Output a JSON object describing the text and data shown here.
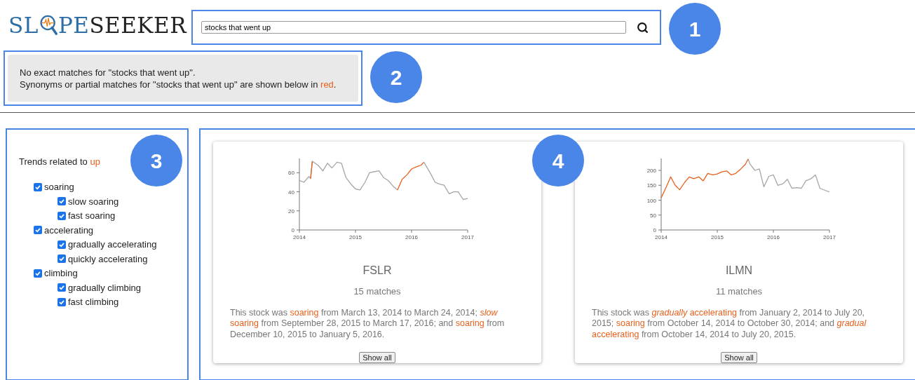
{
  "logo": {
    "accent_start": "SL",
    "accent_end": "PE",
    "rest": "SEEKER"
  },
  "search": {
    "value": "stocks that went up"
  },
  "message": {
    "lines": [
      [
        {
          "text": "No exact matches for \"stocks that went up\".",
          "kind": "plain"
        }
      ],
      [
        {
          "text": "Synonyms or partial matches for \"stocks that went up\" are shown below in ",
          "kind": "plain"
        },
        {
          "text": "red",
          "kind": "match"
        },
        {
          "text": ".",
          "kind": "plain"
        }
      ]
    ]
  },
  "sidebar": {
    "heading": [
      {
        "text": "Trends related to ",
        "kind": "plain"
      },
      {
        "text": "up",
        "kind": "match"
      }
    ],
    "items": [
      {
        "label": "soaring",
        "checked": true,
        "children": [
          {
            "label": "slow soaring",
            "checked": true
          },
          {
            "label": "fast soaring",
            "checked": true
          }
        ]
      },
      {
        "label": "accelerating",
        "checked": true,
        "children": [
          {
            "label": "gradually accelerating",
            "checked": true
          },
          {
            "label": "quickly accelerating",
            "checked": true
          }
        ]
      },
      {
        "label": "climbing",
        "checked": true,
        "children": [
          {
            "label": "gradually climbing",
            "checked": true
          },
          {
            "label": "fast climbing",
            "checked": true
          }
        ]
      }
    ]
  },
  "results": [
    {
      "ticker": "FSLR",
      "matches": "15 matches",
      "description": [
        {
          "text": "This stock was ",
          "kind": "plain"
        },
        {
          "text": "soaring",
          "kind": "match"
        },
        {
          "text": " from March 13, 2014 to March 24, 2014; ",
          "kind": "plain"
        },
        {
          "text": "slow",
          "kind": "match_italic"
        },
        {
          "text": " soaring",
          "kind": "match"
        },
        {
          "text": " from September 28, 2015 to March 17, 2016; and ",
          "kind": "plain"
        },
        {
          "text": "soaring",
          "kind": "match"
        },
        {
          "text": " from December 10, 2015 to January 5, 2016.",
          "kind": "plain"
        }
      ],
      "button": "Show all",
      "chart_data": {
        "type": "line",
        "x": [
          2014,
          2014.08,
          2014.17,
          2014.2,
          2014.23,
          2014.33,
          2014.42,
          2014.5,
          2014.58,
          2014.67,
          2014.75,
          2014.83,
          2014.92,
          2015,
          2015.08,
          2015.17,
          2015.25,
          2015.33,
          2015.42,
          2015.5,
          2015.58,
          2015.67,
          2015.75,
          2015.83,
          2015.92,
          2016,
          2016.08,
          2016.17,
          2016.22,
          2016.33,
          2016.42,
          2016.5,
          2016.58,
          2016.67,
          2016.75,
          2016.83,
          2016.92,
          2017
        ],
        "series": [
          {
            "color": "#a6a6a6",
            "values": [
              52,
              50,
              56,
              54,
              72,
              68,
              62,
              70,
              65,
              71,
              70,
              55,
              48,
              43,
              42,
              50,
              60,
              61,
              62,
              55,
              52,
              46,
              42,
              null,
              null,
              null,
              null,
              null,
              71,
              60,
              50,
              48,
              47,
              38,
              40,
              40,
              32,
              33
            ]
          },
          {
            "color": "#e8601c",
            "values": [
              null,
              null,
              null,
              54,
              72,
              null,
              null,
              null,
              null,
              null,
              null,
              null,
              null,
              null,
              null,
              null,
              null,
              null,
              null,
              null,
              null,
              null,
              42,
              53,
              58,
              64,
              66,
              68,
              71,
              null,
              null,
              null,
              null,
              null,
              null,
              null,
              null,
              null
            ]
          }
        ],
        "xlim": [
          2014,
          2017
        ],
        "ylim": [
          0,
          75
        ],
        "xticks": [
          2014,
          2015,
          2016,
          2017
        ],
        "yticks": [
          0,
          20,
          40,
          60
        ]
      }
    },
    {
      "ticker": "ILMN",
      "matches": "11 matches",
      "description": [
        {
          "text": "This stock was ",
          "kind": "plain"
        },
        {
          "text": "gradually",
          "kind": "match_italic"
        },
        {
          "text": " accelerating",
          "kind": "match"
        },
        {
          "text": " from January 2, 2014 to July 20, 2015; ",
          "kind": "plain"
        },
        {
          "text": "soaring",
          "kind": "match"
        },
        {
          "text": " from October 14, 2014 to October 30, 2014; and ",
          "kind": "plain"
        },
        {
          "text": "gradual",
          "kind": "match_italic"
        },
        {
          "text": " accelerating",
          "kind": "match"
        },
        {
          "text": " from October 14, 2014 to July 20, 2015.",
          "kind": "plain"
        }
      ],
      "button": "Show all",
      "chart_data": {
        "type": "line",
        "x": [
          2014,
          2014.08,
          2014.17,
          2014.25,
          2014.33,
          2014.42,
          2014.5,
          2014.58,
          2014.67,
          2014.75,
          2014.83,
          2014.92,
          2015,
          2015.08,
          2015.17,
          2015.25,
          2015.33,
          2015.42,
          2015.5,
          2015.55,
          2015.58,
          2015.67,
          2015.75,
          2015.83,
          2015.92,
          2016,
          2016.08,
          2016.17,
          2016.25,
          2016.33,
          2016.42,
          2016.5,
          2016.58,
          2016.67,
          2016.75,
          2016.83,
          2016.92,
          2017
        ],
        "series": [
          {
            "color": "#a6a6a6",
            "values": [
              null,
              null,
              null,
              null,
              null,
              null,
              null,
              null,
              null,
              null,
              null,
              null,
              null,
              null,
              null,
              null,
              null,
              null,
              null,
              238,
              222,
              200,
              205,
              145,
              180,
              185,
              150,
              155,
              170,
              140,
              142,
              140,
              165,
              172,
              185,
              140,
              133,
              128
            ]
          },
          {
            "color": "#e8601c",
            "values": [
              108,
              140,
              178,
              150,
              135,
              160,
              178,
              172,
              178,
              165,
              190,
              185,
              188,
              195,
              198,
              185,
              190,
              205,
              220,
              238,
              null,
              null,
              null,
              null,
              null,
              null,
              null,
              null,
              null,
              null,
              null,
              null,
              null,
              null,
              null,
              null,
              null,
              null
            ]
          }
        ],
        "xlim": [
          2014,
          2017
        ],
        "ylim": [
          0,
          240
        ],
        "xticks": [
          2014,
          2015,
          2016,
          2017
        ],
        "yticks": [
          0,
          50,
          100,
          150,
          200
        ]
      }
    }
  ],
  "callouts": [
    "1",
    "2",
    "3",
    "4"
  ]
}
